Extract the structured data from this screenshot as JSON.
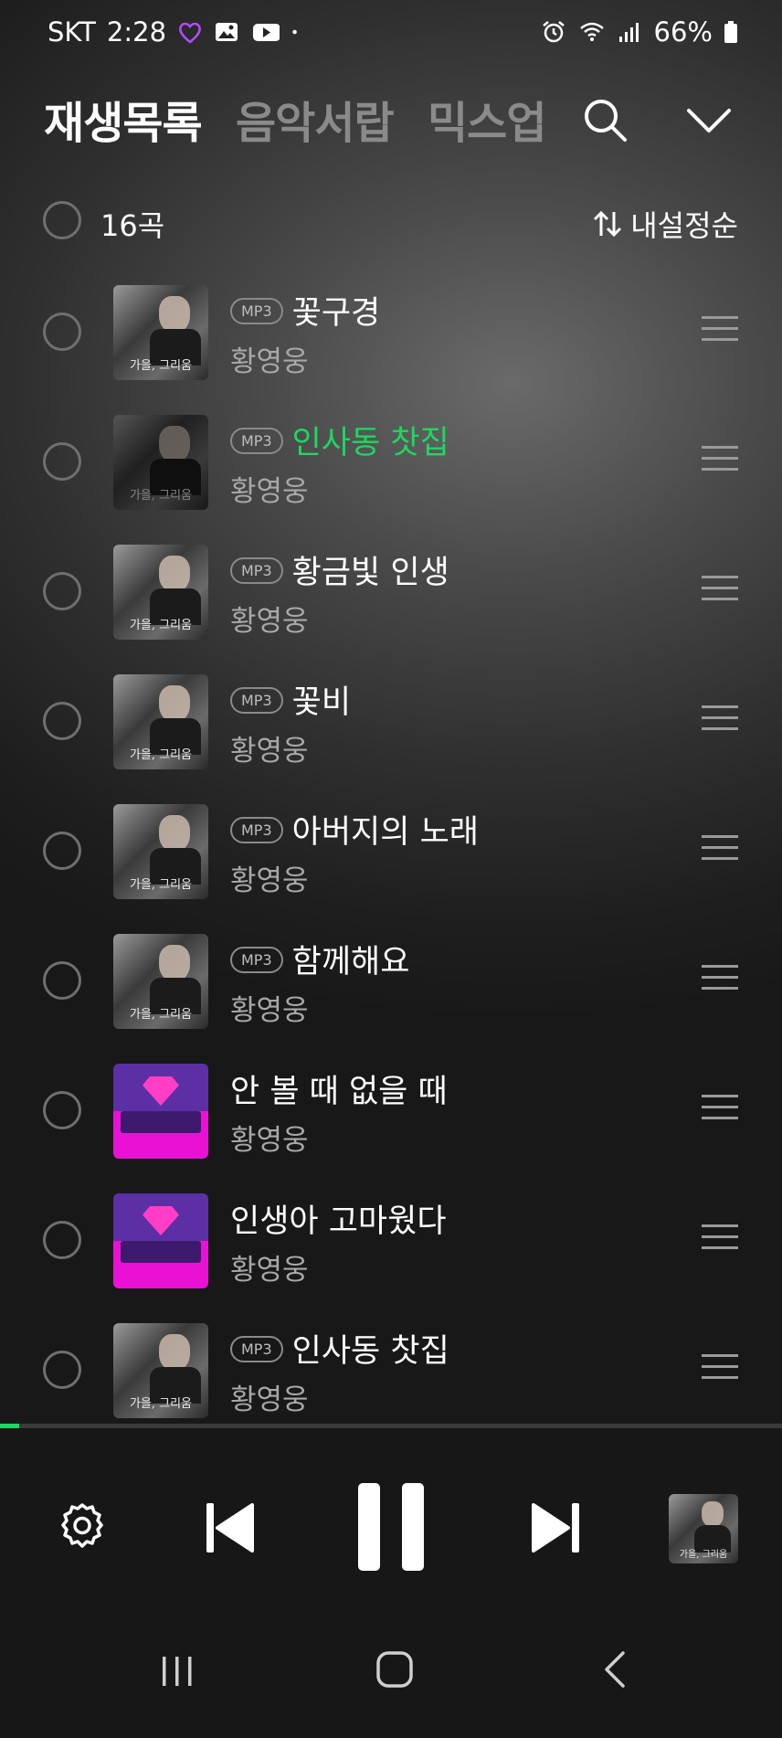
{
  "status_bar": {
    "carrier": "SKT",
    "time": "2:28",
    "battery": "66%",
    "icons": [
      "heart-icon",
      "gallery-icon",
      "youtube-icon",
      "dot-icon",
      "alarm-icon",
      "wifi-icon",
      "signal-icon",
      "battery-icon"
    ]
  },
  "header": {
    "tabs": [
      {
        "label": "재생목록",
        "active": true
      },
      {
        "label": "음악서랍",
        "active": false
      },
      {
        "label": "믹스업",
        "active": false
      }
    ],
    "icons": [
      "search-icon",
      "chevron-down-icon"
    ]
  },
  "list_header": {
    "count": "16곡",
    "sort_label": "내설정순",
    "sort_icon": "sort-icon"
  },
  "tracks": [
    {
      "badge": "MP3",
      "title": "꽃구경",
      "artist": "황영웅",
      "art": "photo",
      "art_caption": "가을, 그리움",
      "playing": false
    },
    {
      "badge": "MP3",
      "title": "인사동 찻집",
      "artist": "황영웅",
      "art": "photo",
      "art_caption": "가을, 그리움",
      "playing": true
    },
    {
      "badge": "MP3",
      "title": "황금빛 인생",
      "artist": "황영웅",
      "art": "photo",
      "art_caption": "가을, 그리움",
      "playing": false
    },
    {
      "badge": "MP3",
      "title": "꽃비",
      "artist": "황영웅",
      "art": "photo",
      "art_caption": "가을, 그리움",
      "playing": false
    },
    {
      "badge": "MP3",
      "title": "아버지의 노래",
      "artist": "황영웅",
      "art": "photo",
      "art_caption": "가을, 그리움",
      "playing": false
    },
    {
      "badge": "MP3",
      "title": "함께해요",
      "artist": "황영웅",
      "art": "photo",
      "art_caption": "가을, 그리움",
      "playing": false
    },
    {
      "badge": "",
      "title": "안 볼 때 없을 때",
      "artist": "황영웅",
      "art": "promo",
      "art_caption": "",
      "playing": false
    },
    {
      "badge": "",
      "title": "인생아 고마웠다",
      "artist": "황영웅",
      "art": "promo",
      "art_caption": "",
      "playing": false
    },
    {
      "badge": "MP3",
      "title": "인사동 찻집",
      "artist": "황영웅",
      "art": "photo",
      "art_caption": "가을, 그리움",
      "playing": false
    }
  ],
  "player": {
    "progress": 0.025,
    "now_playing_caption": "가을, 그리움",
    "controls": [
      "settings-icon",
      "skip-previous-icon",
      "pause-icon",
      "skip-next-icon"
    ]
  },
  "nav_bar": [
    "recents-icon",
    "home-icon",
    "back-icon"
  ],
  "colors": {
    "accent": "#1ed760",
    "inactive_tab": "#8a8a8a",
    "artist_text": "#a8a8a8"
  }
}
